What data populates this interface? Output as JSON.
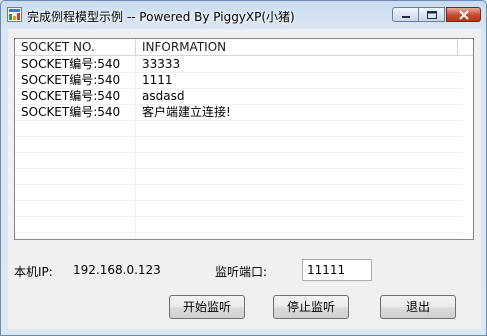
{
  "window": {
    "title": "完成例程模型示例  --  Powered By PiggyXP(小猪)"
  },
  "listview": {
    "columns": [
      "SOCKET NO.",
      "INFORMATION"
    ],
    "rows": [
      {
        "socket": "SOCKET编号:540",
        "info": "33333"
      },
      {
        "socket": "SOCKET编号:540",
        "info": "1111"
      },
      {
        "socket": "SOCKET编号:540",
        "info": "asdasd"
      },
      {
        "socket": "SOCKET编号:540",
        "info": "客户端建立连接!"
      }
    ]
  },
  "local_ip": {
    "label": "本机IP:",
    "value": "192.168.0.123"
  },
  "port": {
    "label": "监听端口:",
    "value": "11111"
  },
  "buttons": {
    "start": "开始监听",
    "stop": "停止监听",
    "exit": "退出"
  }
}
